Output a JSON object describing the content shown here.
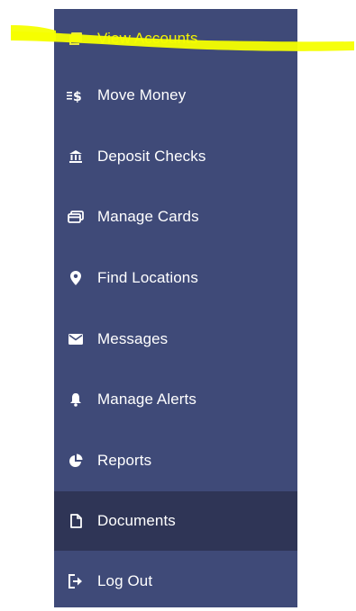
{
  "colors": {
    "sidebar_bg": "#3f4a78",
    "active_bg": "#2f3556",
    "highlight": "#f6ff00",
    "text": "#ffffff"
  },
  "nav": {
    "items": [
      {
        "label": "View Accounts",
        "icon": "accounts-icon"
      },
      {
        "label": "Move Money",
        "icon": "transfer-dollar-icon"
      },
      {
        "label": "Deposit Checks",
        "icon": "bank-icon"
      },
      {
        "label": "Manage Cards",
        "icon": "cards-icon"
      },
      {
        "label": "Find Locations",
        "icon": "location-pin-icon"
      },
      {
        "label": "Messages",
        "icon": "envelope-icon"
      },
      {
        "label": "Manage Alerts",
        "icon": "bell-icon"
      },
      {
        "label": "Reports",
        "icon": "pie-chart-icon"
      },
      {
        "label": "Documents",
        "icon": "document-icon"
      },
      {
        "label": "Log Out",
        "icon": "logout-icon"
      }
    ]
  }
}
